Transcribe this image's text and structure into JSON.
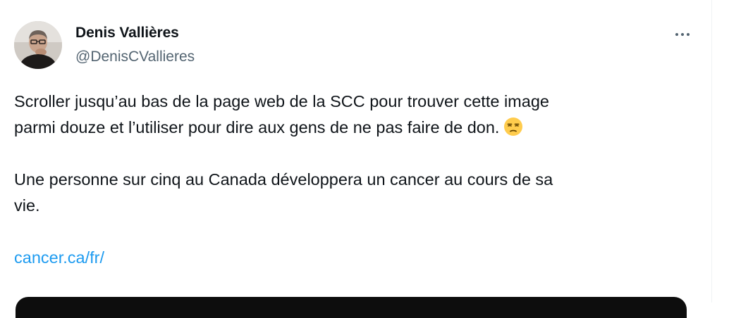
{
  "tweet": {
    "author": {
      "display_name": "Denis Vallières",
      "handle": "@DenisCValliere s"
    },
    "more_icon": "more-horizontal-icon",
    "body": {
      "paragraph1_line1": "Scroller jusqu’au bas de la page web de la SCC pour trouver cette image",
      "paragraph1_line2": "parmi douze et l’utiliser pour dire aux gens de ne pas faire de don.",
      "emoji": "unamused-face-emoji",
      "paragraph2_line1": "Une personne sur cinq au Canada développera un cancer au cours de sa",
      "paragraph2_line2": "vie.",
      "link": "cancer.ca/fr/"
    }
  },
  "colors": {
    "text": "#0f1419",
    "secondary": "#536471",
    "link": "#1d9bf0"
  }
}
